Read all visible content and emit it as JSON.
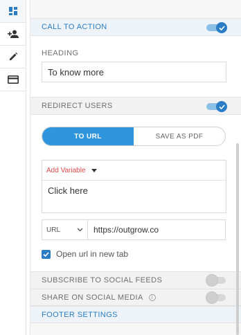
{
  "rail": {
    "items": [
      {
        "icon": "dashboard-icon",
        "active": true
      },
      {
        "icon": "add-user-icon",
        "active": false
      },
      {
        "icon": "pencil-icon",
        "active": false
      },
      {
        "icon": "card-icon",
        "active": false
      }
    ]
  },
  "cta": {
    "label": "CALL TO ACTION",
    "enabled": true
  },
  "heading": {
    "label": "HEADING",
    "value": "To know more"
  },
  "redirect": {
    "label": "REDIRECT USERS",
    "enabled": true,
    "tabs": {
      "to_url": "TO URL",
      "save_pdf": "SAVE AS PDF",
      "selected": "to_url"
    },
    "editor": {
      "add_variable": "Add Variable",
      "text": "Click here"
    },
    "url": {
      "type": "URL",
      "value": "https://outgrow.co"
    },
    "new_tab": {
      "label": "Open url in new tab",
      "checked": true
    }
  },
  "subscribe": {
    "label": "SUBSCRIBE TO SOCIAL FEEDS",
    "enabled": false
  },
  "share": {
    "label": "SHARE ON SOCIAL MEDIA",
    "enabled": false
  },
  "footer": {
    "label": "FOOTER SETTINGS"
  },
  "colors": {
    "accent": "#2a7dc4",
    "segment": "#2f96dd",
    "variable": "#d94a4a"
  }
}
